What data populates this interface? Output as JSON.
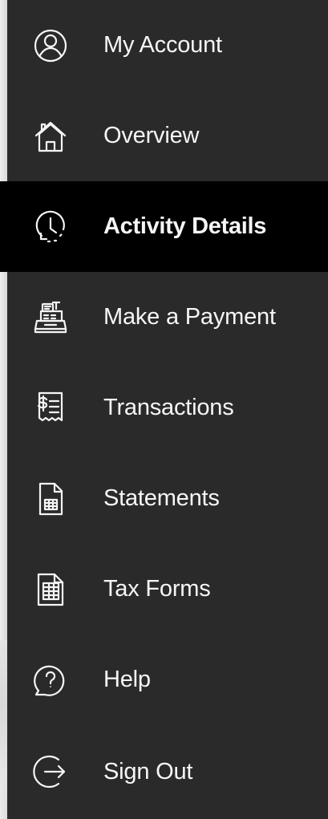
{
  "menu": {
    "items": [
      {
        "label": "My Account",
        "icon": "user-circle-icon"
      },
      {
        "label": "Overview",
        "icon": "home-icon"
      },
      {
        "label": "Activity Details",
        "icon": "clock-history-icon",
        "active": true
      },
      {
        "label": "Make a Payment",
        "icon": "cash-register-icon"
      },
      {
        "label": "Transactions",
        "icon": "receipt-dollar-icon"
      },
      {
        "label": "Statements",
        "icon": "statement-document-icon"
      },
      {
        "label": "Tax Forms",
        "icon": "tax-form-document-icon"
      },
      {
        "label": "Help",
        "icon": "help-bubble-icon"
      },
      {
        "label": "Sign Out",
        "icon": "sign-out-icon"
      }
    ]
  },
  "colors": {
    "menu_background": "#2a2a2a",
    "active_background": "#000000",
    "text": "#f6f6f6",
    "page_background": "#f3f3f3"
  }
}
